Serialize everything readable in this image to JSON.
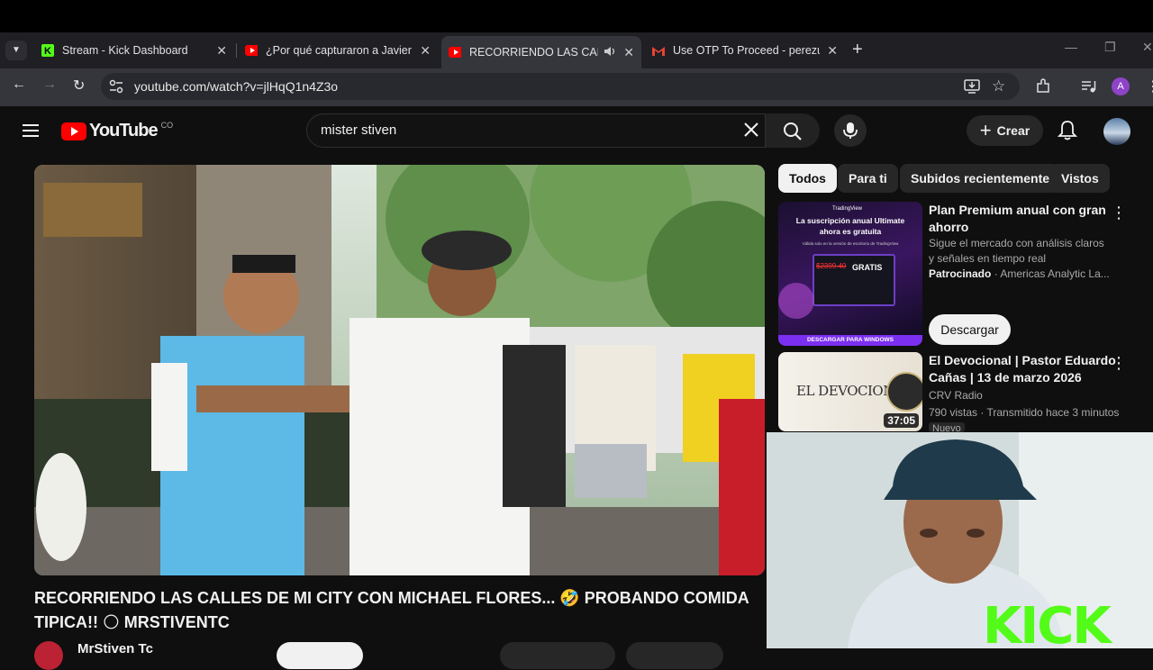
{
  "browser": {
    "tabs": [
      {
        "title": "Stream - Kick Dashboard",
        "favicon": "kick-icon"
      },
      {
        "title": "¿Por qué capturaron a Javier Ar",
        "favicon": "youtube-icon"
      },
      {
        "title": "RECORRIENDO LAS CALLES",
        "favicon": "youtube-icon",
        "active": true
      },
      {
        "title": "Use OTP To Proceed - perezurz",
        "favicon": "gmail-icon"
      }
    ],
    "close_glyph": "✕",
    "new_tab": "+",
    "url": "youtube.com/watch?v=jlHqQ1n4Z3o",
    "profile_initial": "A"
  },
  "youtube": {
    "logo_text": "YouTube",
    "country_code": "CO",
    "search_value": "mister stiven",
    "create_label": "Crear",
    "video_title": "RECORRIENDO LAS CALLES DE MI CITY CON MICHAEL FLORES... 🤣 PROBANDO COMIDA TIPICA!! 🌕 MRSTIVENTC",
    "channel_partial": "MrStiven Tc",
    "chips": [
      "Todos",
      "Para ti",
      "Subidos recientemente",
      "Vistos"
    ],
    "recommendations": [
      {
        "title_line1": "Plan Premium anual con gran",
        "title_line2": "ahorro",
        "desc_line1": "Sigue el mercado con análisis claros",
        "desc_line2": "y señales en tiempo real",
        "sponsored": "Patrocinado",
        "advertiser": "· Americas Analytic La...",
        "button": "Descargar",
        "thumb_brand": "TradingView",
        "thumb_line1": "La suscripción anual Ultimate",
        "thumb_line2": "ahora es gratuita",
        "thumb_sub": "Válida solo en la versión de escritorio de TradingView",
        "thumb_price": "$2399.40",
        "thumb_free": "GRATIS",
        "thumb_footer": "DESCARGAR PARA WINDOWS"
      },
      {
        "title_line1": "El Devocional | Pastor Eduardo",
        "title_line2": "Cañas | 13 de marzo 2026",
        "channel": "CRV Radio",
        "meta": "790 vistas · Transmitido hace 3 minutos",
        "duration": "37:05",
        "badge": "Nuevo",
        "thumb_text": "EL DEVOCIONAL"
      }
    ]
  },
  "overlay": {
    "kick_text": "KICK"
  },
  "colors": {
    "yt_red": "#ff0000",
    "kick_green": "#53fc18",
    "bg": "#0f0f0f"
  }
}
